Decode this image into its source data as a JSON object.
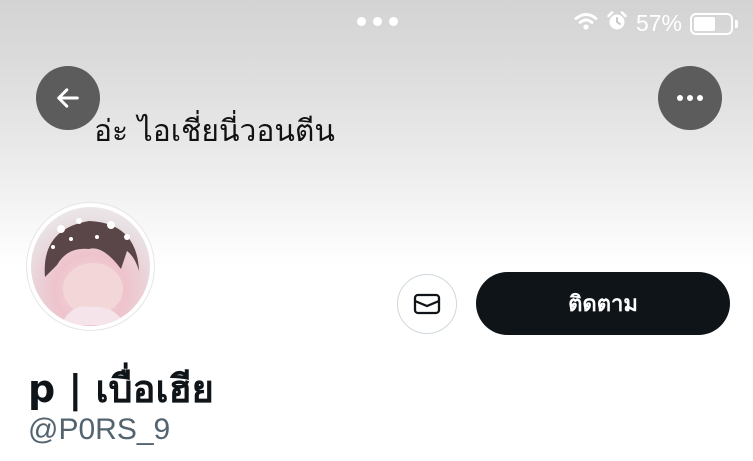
{
  "status_bar": {
    "battery_percent": "57%",
    "battery_level": 0.57,
    "icons": [
      "wifi-icon",
      "alarm-icon",
      "battery-icon"
    ]
  },
  "header": {
    "back_icon": "arrow-left-icon",
    "more_icon": "more-horizontal-icon",
    "banner_text": "อ่ะ ไอเชี่ยนี่วอนตีน"
  },
  "profile": {
    "display_name": "p | เบื่อเฮีย",
    "handle": "@P0RS_9",
    "message_icon": "envelope-icon",
    "follow_label": "ติดตาม"
  },
  "colors": {
    "button_dark": "#0f1419",
    "handle_gray": "#536471",
    "overlay_button": "#5c5c5c"
  }
}
